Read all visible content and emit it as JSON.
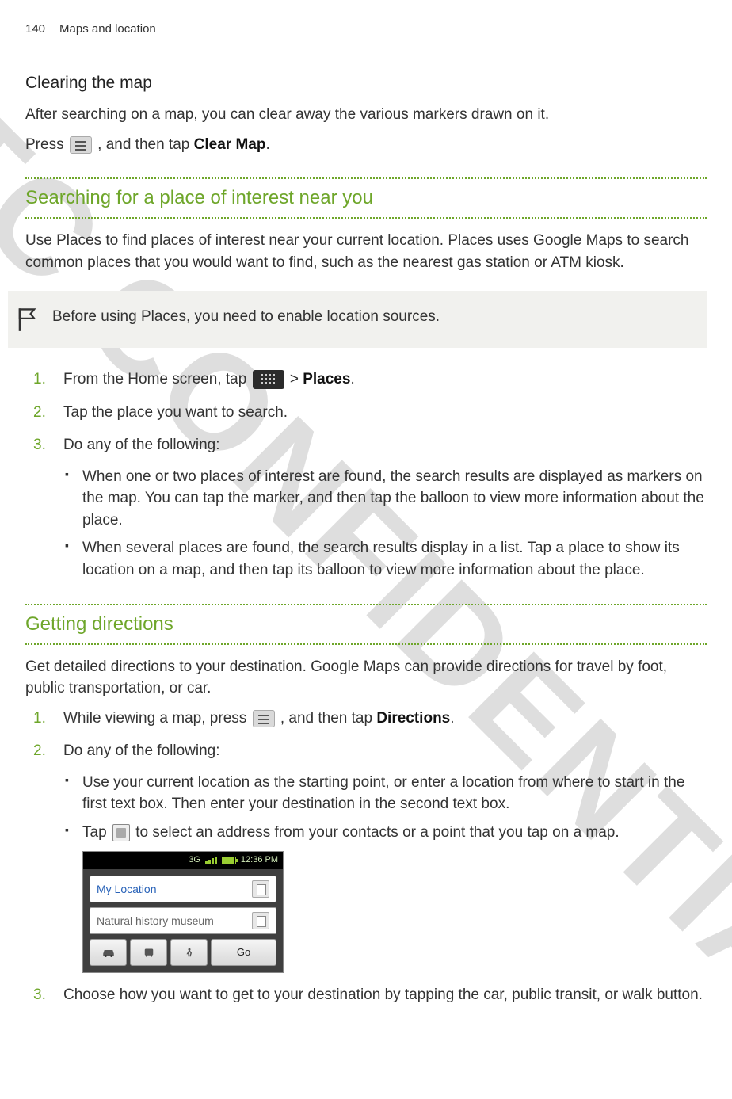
{
  "header": {
    "page_number": "140",
    "chapter": "Maps and location"
  },
  "section1": {
    "heading": "Clearing the map",
    "p1": "After searching on a map, you can clear away the various markers drawn on it.",
    "p2a": "Press ",
    "p2b": " , and then tap ",
    "p2_bold": "Clear Map",
    "p2c": "."
  },
  "section2": {
    "title": "Searching for a place of interest near you",
    "intro": "Use Places to find places of interest near your current location. Places uses Google Maps to search common places that you would want to find, such as the nearest gas station or ATM kiosk.",
    "note": "Before using Places, you need to enable location sources.",
    "step1a": "From the Home screen, tap ",
    "step1b": " > ",
    "step1_bold": "Places",
    "step1c": ".",
    "step2": "Tap the place you want to search.",
    "step3": "Do any of the following:",
    "b1": "When one or two places of interest are found, the search results are displayed as markers on the map. You can tap the marker, and then tap the balloon to view more information about the place.",
    "b2": "When several places are found, the search results display in a list. Tap a place to show its location on a map, and then tap its balloon to view more information about the place."
  },
  "section3": {
    "title": "Getting directions",
    "intro": "Get detailed directions to your destination. Google Maps can provide directions for travel by foot, public transportation, or car.",
    "step1a": "While viewing a map, press ",
    "step1b": " , and then tap ",
    "step1_bold": "Directions",
    "step1c": ".",
    "step2": "Do any of the following:",
    "b1": "Use your current location as the starting point, or enter a location from where to start in the first text box. Then enter your destination in the second text box.",
    "b2a": "Tap ",
    "b2b": " to select an address from your contacts or a point that you tap on a map.",
    "step3": "Choose how you want to get to your destination by tapping the car, public transit, or walk button."
  },
  "phone": {
    "status_3g": "3G",
    "status_time": "12:36 PM",
    "field1": "My Location",
    "field2": "Natural history museum",
    "button_go": "Go"
  }
}
